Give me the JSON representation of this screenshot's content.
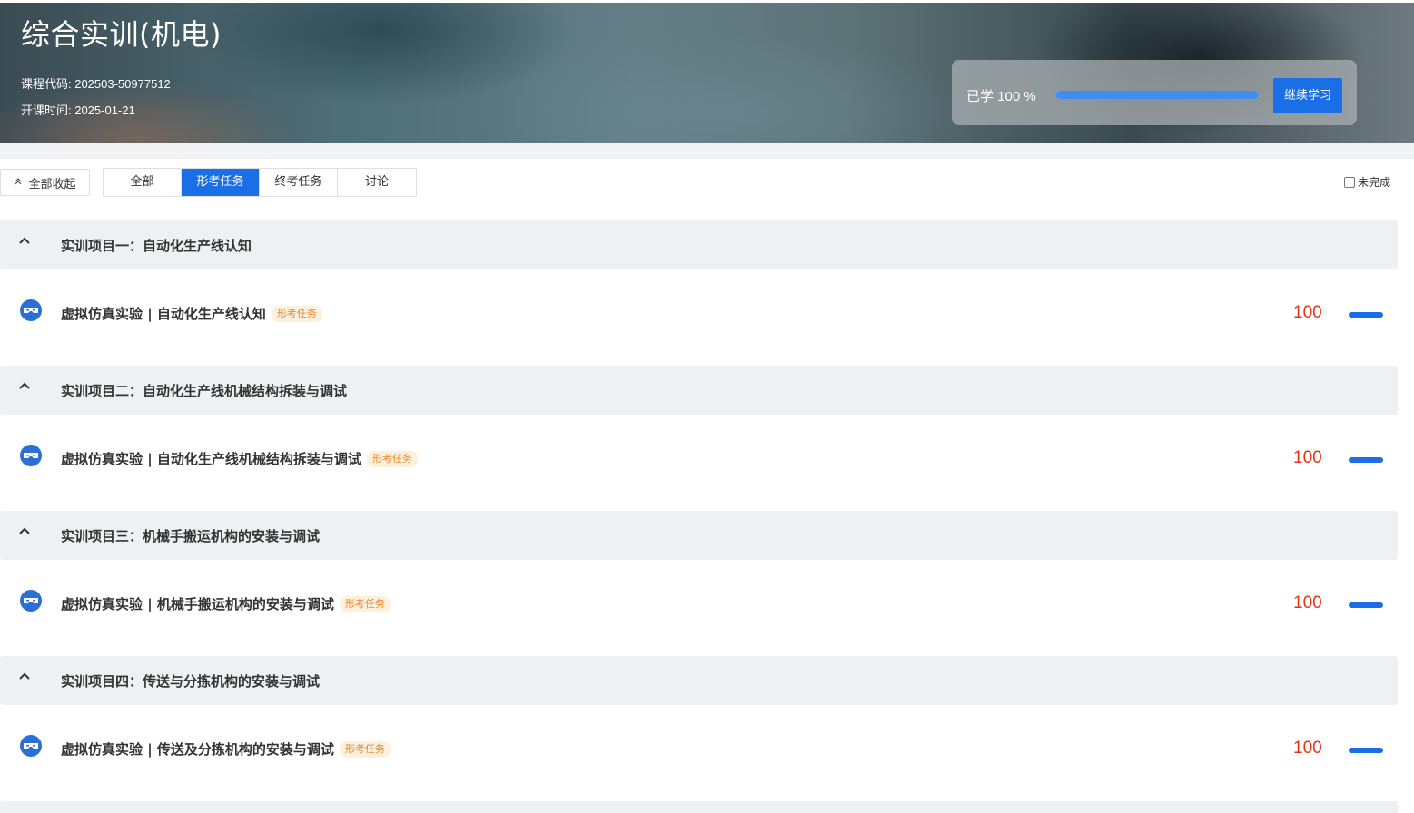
{
  "header": {
    "title": "综合实训(机电)",
    "course_code": "课程代码: 202503-50977512",
    "start_date": "开课时间: 2025-01-21"
  },
  "progress": {
    "label": "已学 100 %",
    "percent": 100,
    "continue_label": "继续学习",
    "track_color": "#d7e6fb",
    "fill_color": "#3f8df0"
  },
  "toolbar": {
    "collapse_all_label": "全部收起",
    "tabs": [
      {
        "label": "全部",
        "active": false
      },
      {
        "label": "形考任务",
        "active": true
      },
      {
        "label": "终考任务",
        "active": false
      },
      {
        "label": "讨论",
        "active": false
      }
    ],
    "filter_incomplete_label": "未完成",
    "filter_incomplete_checked": false
  },
  "colors": {
    "accent": "#1a6ee6",
    "score": "#e1351a",
    "tag_text": "#e6882e",
    "tag_bg": "#fdf0dd"
  },
  "sections": [
    {
      "title": "实训项目一：自动化生产线认知",
      "task": {
        "title": "虚拟仿真实验 | 自动化生产线认知",
        "tag": "形考任务",
        "score": "100",
        "icon": "vr-headset-icon"
      }
    },
    {
      "title": "实训项目二：自动化生产线机械结构拆装与调试",
      "task": {
        "title": "虚拟仿真实验 | 自动化生产线机械结构拆装与调试",
        "tag": "形考任务",
        "score": "100",
        "icon": "vr-headset-icon"
      }
    },
    {
      "title": "实训项目三：机械手搬运机构的安装与调试",
      "task": {
        "title": "虚拟仿真实验 | 机械手搬运机构的安装与调试",
        "tag": "形考任务",
        "score": "100",
        "icon": "vr-headset-icon"
      }
    },
    {
      "title": "实训项目四：传送与分拣机构的安装与调试",
      "task": {
        "title": "虚拟仿真实验 | 传送及分拣机构的安装与调试",
        "tag": "形考任务",
        "score": "100",
        "icon": "vr-headset-icon"
      }
    }
  ]
}
